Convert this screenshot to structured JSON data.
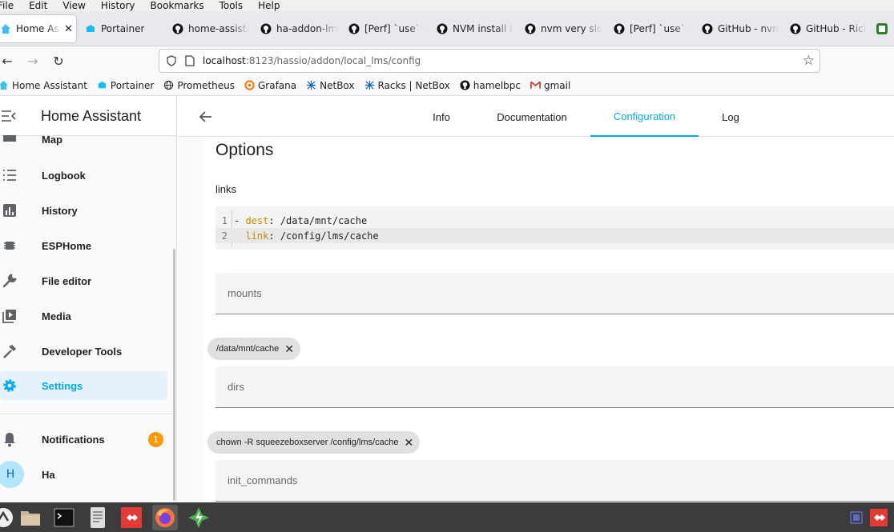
{
  "menubar": [
    "File",
    "Edit",
    "View",
    "History",
    "Bookmarks",
    "Tools",
    "Help"
  ],
  "tabs": [
    {
      "label": "Home Assistant",
      "icon": "home-assistant-icon",
      "active": true
    },
    {
      "label": "Portainer",
      "icon": "portainer-icon"
    },
    {
      "label": "home-assistant",
      "icon": "github-icon"
    },
    {
      "label": "ha-addon-lms",
      "icon": "github-icon"
    },
    {
      "label": "[Perf] `use` /",
      "icon": "github-icon"
    },
    {
      "label": "NVM install hangs",
      "icon": "github-icon"
    },
    {
      "label": "nvm very slow",
      "icon": "github-icon"
    },
    {
      "label": "[Perf] `use` /",
      "icon": "github-icon"
    },
    {
      "label": "GitHub - nvm",
      "icon": "github-icon"
    },
    {
      "label": "GitHub - Rich",
      "icon": "github-icon"
    }
  ],
  "url": {
    "host": "localhost",
    "path": ":8123/hassio/addon/local_lms/config"
  },
  "bookmarks": [
    {
      "label": "Home Assistant",
      "icon": "home-assistant-icon"
    },
    {
      "label": "Portainer",
      "icon": "portainer-icon"
    },
    {
      "label": "Prometheus",
      "icon": "globe-icon"
    },
    {
      "label": "Grafana",
      "icon": "grafana-icon"
    },
    {
      "label": "NetBox",
      "icon": "netbox-icon"
    },
    {
      "label": "Racks | NetBox",
      "icon": "netbox-icon"
    },
    {
      "label": "hamelbpc",
      "icon": "github-icon"
    },
    {
      "label": "gmail",
      "icon": "gmail-icon"
    }
  ],
  "sidebar": {
    "title": "Home Assistant",
    "items": [
      {
        "label": "Map",
        "icon": "map-icon"
      },
      {
        "label": "Logbook",
        "icon": "logbook-icon"
      },
      {
        "label": "History",
        "icon": "history-icon"
      },
      {
        "label": "ESPHome",
        "icon": "chip-icon"
      },
      {
        "label": "File editor",
        "icon": "wrench-icon"
      },
      {
        "label": "Media",
        "icon": "media-icon"
      },
      {
        "label": "Developer Tools",
        "icon": "hammer-icon"
      },
      {
        "label": "Settings",
        "icon": "gear-icon",
        "selected": true
      }
    ],
    "notifications": {
      "label": "Notifications",
      "count": "1"
    },
    "user": {
      "label": "Ha",
      "initial": "H"
    }
  },
  "main": {
    "tabs": [
      "Info",
      "Documentation",
      "Configuration",
      "Log"
    ],
    "active_tab": "Configuration",
    "options_title": "Options",
    "links_label": "links",
    "code": {
      "line1": {
        "num": "1",
        "key": "dest",
        "value": "/data/mnt/cache"
      },
      "line2": {
        "num": "2",
        "key": "link",
        "value": "/config/lms/cache"
      }
    },
    "fields": {
      "mounts": "mounts",
      "dirs": "dirs",
      "init_commands": "init_commands"
    },
    "chips": {
      "dirs_chip": "/data/mnt/cache",
      "init_chip": "chown -R squeezeboxserver /config/lms/cache"
    }
  },
  "colors": {
    "accent": "#03a9f4",
    "badge": "#ff9800",
    "taskbar": "#3c3c3c"
  }
}
